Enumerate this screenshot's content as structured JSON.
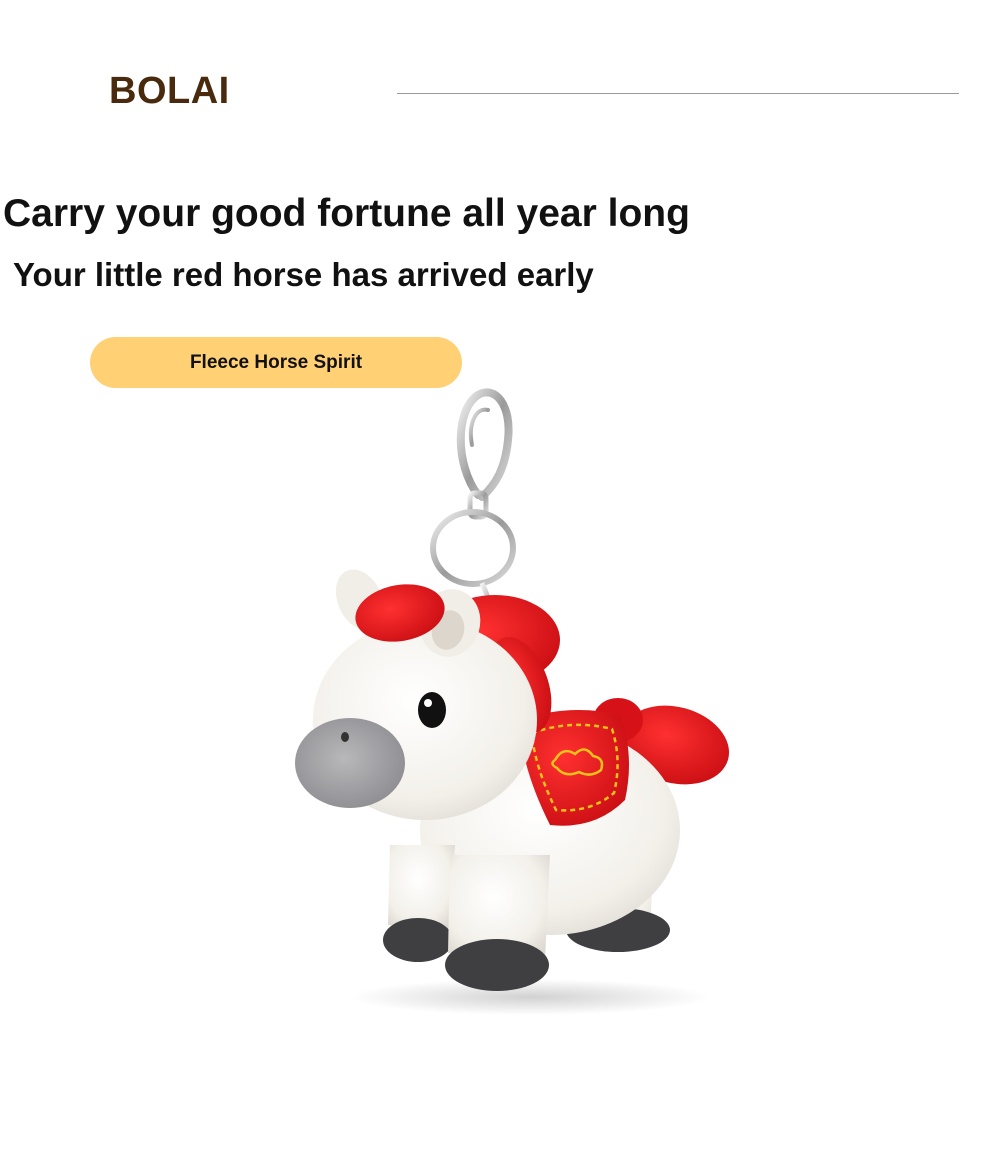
{
  "brand": {
    "name": "BOLAI",
    "color": "#4a2a0c"
  },
  "hero": {
    "headline": "Carry your good fortune all year long",
    "subheadline": "Your little red horse has arrived early"
  },
  "product": {
    "tag_label": "Fleece Horse Spirit",
    "tag_color": "#ffd074",
    "image_icon": "plush-horse-keychain"
  },
  "colors": {
    "accent_red": "#e0141b",
    "plush_white": "#f4f1ec",
    "hoof_gray": "#3f3f42"
  }
}
